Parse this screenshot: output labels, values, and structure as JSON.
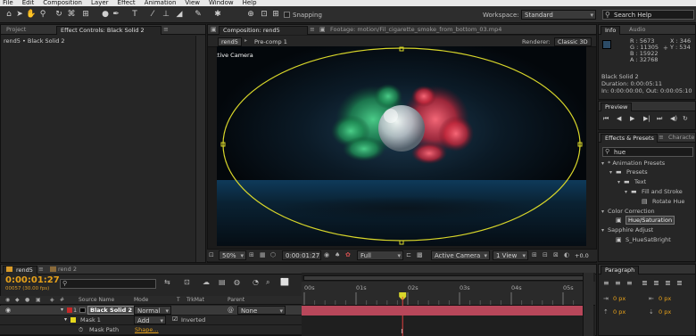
{
  "menu": [
    "File",
    "Edit",
    "Composition",
    "Layer",
    "Effect",
    "Animation",
    "View",
    "Window",
    "Help"
  ],
  "toolbar": {
    "snapping_label": "Snapping",
    "workspace_label": "Workspace:",
    "workspace_value": "Standard",
    "search_placeholder": "Search Help"
  },
  "left_panel": {
    "tab_project": "Project",
    "tab_effect_controls": "Effect Controls: Black Solid 2",
    "breadcrumb": "rend5 • Black Solid 2"
  },
  "comp_panel": {
    "tab_composition": "Composition: rend5",
    "tab_footage": "Footage: motion/Fil_cigarette_smoke_from_bottom_03.mp4",
    "sub_tab_1": "rend5",
    "sub_tab_2": "Pre-comp 1",
    "renderer_label": "Renderer:",
    "renderer_value": "Classic 3D",
    "camera_label": "Active Camera"
  },
  "viewer_footer": {
    "zoom": "50%",
    "timecode": "0:00:01:27",
    "resolution": "Full",
    "camera": "Active Camera",
    "views": "1 View",
    "offset": "+0.0"
  },
  "info_panel": {
    "tab_info": "Info",
    "tab_audio": "Audio",
    "r": "R : 5673",
    "g": "G : 11305",
    "b": "B : 15922",
    "a": "A : 32768",
    "x": "X : 346",
    "y": "Y : 534",
    "layer": "Black Solid 2",
    "duration": "Duration: 0:00:05:11",
    "in_out": "In: 0:00:00:00, Out: 0:00:05:10"
  },
  "preview_panel": {
    "tab": "Preview"
  },
  "effects_panel": {
    "tab_effects": "Effects & Presets",
    "tab_character": "Characte",
    "search_value": "hue",
    "tree": [
      "* Animation Presets",
      "Presets",
      "Text",
      "Fill and Stroke",
      "Rotate Hue",
      "Color Correction",
      "Hue/Saturation",
      "Sapphire Adjust",
      "S_HueSatBright"
    ]
  },
  "timeline": {
    "tab_1": "rend5",
    "tab_2": "rend 2",
    "timecode": "0:00:01:27",
    "frame_info": "00057 (30.00 fps)",
    "col_source": "Source Name",
    "col_mode": "Mode",
    "col_t": "T",
    "col_trkmat": "TrkMat",
    "col_parent": "Parent",
    "layer_num": "1",
    "layer_name": "Black Solid 2",
    "layer_mode": "Normal",
    "parent_value": "None",
    "mask_name": "Mask 1",
    "mask_mode": "Add",
    "inverted_label": "Inverted",
    "mask_path_label": "Mask Path",
    "mask_path_value": "Shape...",
    "ruler": [
      "00s",
      "01s",
      "02s",
      "03s",
      "04s",
      "05s"
    ],
    "playhead_seconds": 1.9,
    "duration_seconds": 5.37
  },
  "paragraph_panel": {
    "tab": "Paragraph",
    "px_1": "0 px",
    "px_2": "0 px",
    "px_3": "0 px",
    "px_4": "0 px"
  },
  "colors": {
    "accent_orange": "#e8a21a",
    "mask_yellow": "#d8d62a",
    "layer_bar": "#b8475a",
    "layer_label_red": "#c62828",
    "mask_label_yellow": "#e6d81c",
    "smoke_green": "#2aa362",
    "smoke_red": "#d83a4c"
  }
}
